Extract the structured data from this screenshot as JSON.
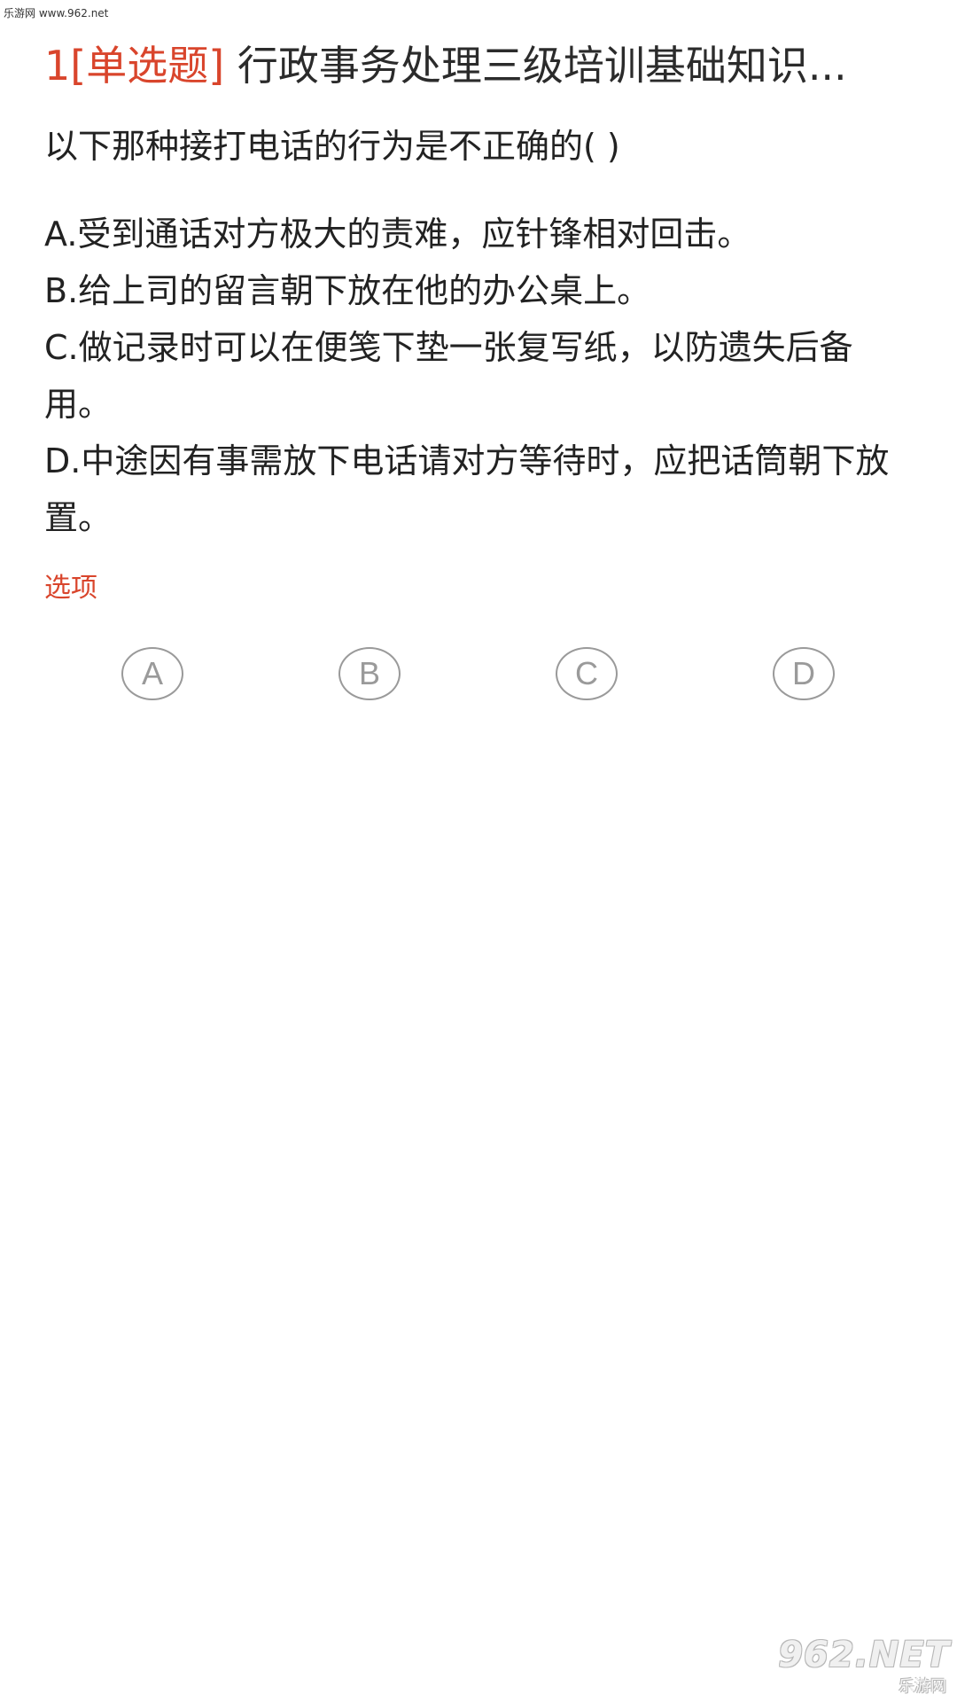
{
  "watermark": {
    "top_text": "乐游网 www.962.net",
    "bottom_main": "962.NET",
    "bottom_sub": "乐游网"
  },
  "question": {
    "number": "1",
    "type": "[单选题]",
    "category": "行政事务处理三级培训基础知识...",
    "text": "以下那种接打电话的行为是不正确的( )",
    "options": [
      "A.受到通话对方极大的责难，应针锋相对回击。",
      "B.给上司的留言朝下放在他的办公桌上。",
      "C.做记录时可以在便笺下垫一张复写纸，以防遗失后备用。",
      "D.中途因有事需放下电话请对方等待时，应把话筒朝下放置。"
    ]
  },
  "answer_section": {
    "label": "选项",
    "choices": [
      "A",
      "B",
      "C",
      "D"
    ]
  },
  "colors": {
    "accent": "#d9452c",
    "text": "#222222",
    "choice_outline": "#9a9a9a"
  }
}
